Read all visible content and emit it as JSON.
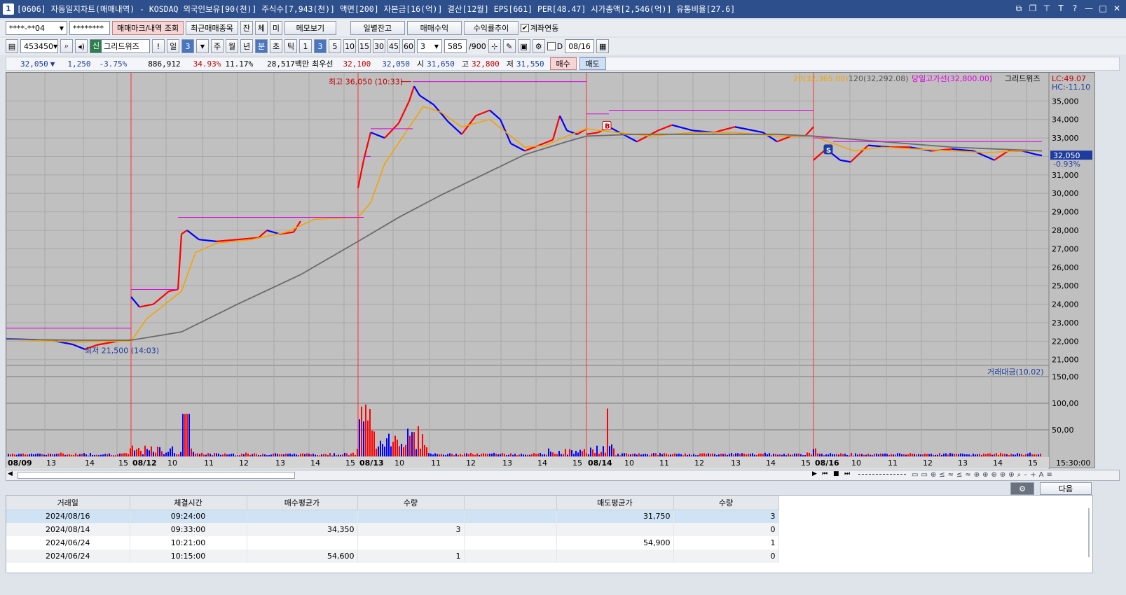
{
  "title": {
    "icon": "1",
    "text": "[0606] 자동일지차트(매매내역) - KOSDAQ 외국인보유[90(천)] 주식수[7,943(천)] 액면[200] 자본금[16(억)] 결산[12월] EPS[661] PER[48.47] 시가총액[2,546(억)] 유통비율[27.6]",
    "ctrl_icons": [
      "layout-icon",
      "copy-icon",
      "pin-icon",
      "font-icon",
      "help-icon",
      "minimize-icon",
      "maximize-icon",
      "close-icon"
    ],
    "ctrl_glyphs": [
      "⧉",
      "❐",
      "⊤",
      "T",
      "?",
      "—",
      "□",
      "✕"
    ]
  },
  "toolbar1": {
    "account": "****-**04",
    "password": "********",
    "btn_view": "매매마크/내역 조회",
    "btn_recent": "최근매매종목",
    "mini_btns": [
      "잔",
      "체",
      "미"
    ],
    "btn_memo": "메모보기",
    "btn_daily": "일별잔고",
    "btn_profit": "매매수익",
    "btn_trend": "수익률추이",
    "link_account_label": "계좌연동",
    "link_account_checked": true
  },
  "toolbar2": {
    "code": "453450",
    "badge": "신",
    "name": "그리드위즈",
    "alert": "!",
    "day_label": "일",
    "day_val": "3",
    "periods": [
      "주",
      "월",
      "년",
      "분",
      "초",
      "틱"
    ],
    "period_selected": "분",
    "intervals": [
      "1",
      "3",
      "5",
      "10",
      "15",
      "30",
      "45",
      "60"
    ],
    "interval_selected": "3",
    "interval_sel_val": "3",
    "count": "585",
    "count_total": "/900",
    "d_label": "D",
    "date": "08/16"
  },
  "quote": {
    "price": "32,050",
    "arrow": "▼",
    "change": "1,250",
    "pct": "-3.75%",
    "volume": "886,912",
    "ratio1": "34.93%",
    "ratio2": "11.17%",
    "amount": "28,517백만",
    "best_label": "최우선",
    "best_ask": "32,100",
    "best_bid": "32,050",
    "open_label": "시",
    "open": "31,650",
    "high_label": "고",
    "high": "32,800",
    "low_label": "저",
    "low": "31,550",
    "buy_btn": "매수",
    "sell_btn": "매도"
  },
  "chart_data": {
    "type": "line",
    "price_axis": [
      "35,000",
      "34,000",
      "33,000",
      "32,000",
      "31,000",
      "30,000",
      "29,000",
      "28,000",
      "27,000",
      "26,000",
      "25,000",
      "24,000",
      "23,000",
      "22,000",
      "21,000"
    ],
    "price_ylim": [
      20800,
      36300
    ],
    "volume_axis": [
      "150,00",
      "100,00",
      "50,00"
    ],
    "x_ticks": [
      "08/09",
      "13",
      "14",
      "15",
      "08/12",
      "10",
      "11",
      "12",
      "13",
      "14",
      "15",
      "08/13",
      "10",
      "11",
      "12",
      "13",
      "14",
      "15",
      "08/14",
      "10",
      "11",
      "12",
      "13",
      "14",
      "15",
      "08/16",
      "10",
      "11",
      "12",
      "13",
      "14",
      "15"
    ],
    "x_time_label": "15:30:00",
    "legend": {
      "ma_short": "20(32,365.00)",
      "ma_long": "120(32,292.08)",
      "day_high_line": "당일고가선(32,800.00)",
      "name": "그리드위즈"
    },
    "lc": "LC:49.07",
    "hc": "HC:-11.10",
    "last_price": "32,050",
    "last_pct": "-0.93%",
    "high_annot": "최고 36,050 (10:33)",
    "low_annot": "최저 21,500 (14:03)",
    "volume_legend": "거래대금(10.02)",
    "marks": [
      {
        "label": "B"
      },
      {
        "label": "S"
      }
    ],
    "colors": {
      "up": "#ff0000",
      "down": "#0000ff",
      "ma_short": "#f5a300",
      "ma_long": "#6b6b6b",
      "high_line": "#e000e0"
    }
  },
  "scroll_glyphs": [
    "◀",
    "▶",
    "⏮",
    "■",
    "⏭"
  ],
  "panel": {
    "settings_icon": "gear-icon",
    "next_btn": "다음"
  },
  "trades": {
    "headers": [
      "거래일",
      "체결시간",
      "매수평균가",
      "수량",
      "",
      "매도평균가",
      "수량"
    ],
    "rows": [
      [
        "2024/08/16",
        "09:24:00",
        "",
        "",
        "",
        "31,750",
        "3"
      ],
      [
        "2024/08/14",
        "09:33:00",
        "34,350",
        "3",
        "",
        "",
        "0"
      ],
      [
        "2024/06/24",
        "10:21:00",
        "",
        "",
        "",
        "54,900",
        "1"
      ],
      [
        "2024/06/24",
        "10:15:00",
        "54,600",
        "1",
        "",
        "",
        "0"
      ]
    ]
  }
}
